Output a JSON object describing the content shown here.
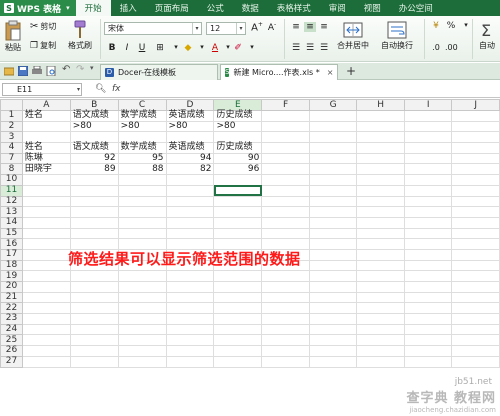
{
  "app": {
    "logo_label": "WPS 表格"
  },
  "menu": {
    "tabs": [
      {
        "label": "开始"
      },
      {
        "label": "插入"
      },
      {
        "label": "页面布局"
      },
      {
        "label": "公式"
      },
      {
        "label": "数据"
      },
      {
        "label": "表格样式"
      },
      {
        "label": "审阅"
      },
      {
        "label": "视图"
      },
      {
        "label": "办公空间"
      }
    ]
  },
  "ribbon": {
    "paste_label": "粘贴",
    "cut_label": "剪切",
    "copy_label": "复制",
    "format_painter_label": "格式刷",
    "font_name": "宋体",
    "font_size": "12",
    "merge_center_label": "合并居中",
    "wrap_text_label": "自动换行",
    "auto_label": "自动"
  },
  "doc_tabs": [
    {
      "label": "Docer-在线模板"
    },
    {
      "label": "新建 Micro....作表.xls *"
    }
  ],
  "formula_bar": {
    "name_box": "E11",
    "fx": "fx",
    "formula": ""
  },
  "sheet": {
    "columns": [
      "A",
      "B",
      "C",
      "D",
      "E",
      "F",
      "G",
      "H",
      "I",
      "J"
    ],
    "selected_column": "E",
    "selected_row": 11,
    "active_cell": "E11",
    "rows": [
      {
        "num": "1",
        "cells": [
          "姓名",
          "语文成绩",
          "数学成绩",
          "英语成绩",
          "历史成绩",
          "",
          "",
          "",
          "",
          ""
        ]
      },
      {
        "num": "2",
        "cells": [
          "",
          ">80",
          ">80",
          ">80",
          ">80",
          "",
          "",
          "",
          "",
          ""
        ]
      },
      {
        "num": "3",
        "cells": [
          "",
          "",
          "",
          "",
          "",
          "",
          "",
          "",
          "",
          ""
        ]
      },
      {
        "num": "4",
        "cells": [
          "姓名",
          "语文成绩",
          "数学成绩",
          "英语成绩",
          "历史成绩",
          "",
          "",
          "",
          "",
          ""
        ]
      },
      {
        "num": "7",
        "cells": [
          "陈琳",
          "92",
          "95",
          "94",
          "90",
          "",
          "",
          "",
          "",
          ""
        ]
      },
      {
        "num": "8",
        "cells": [
          "田晓宇",
          "89",
          "88",
          "82",
          "96",
          "",
          "",
          "",
          "",
          ""
        ]
      },
      {
        "num": "10",
        "cells": [
          "",
          "",
          "",
          "",
          "",
          "",
          "",
          "",
          "",
          ""
        ]
      },
      {
        "num": "11",
        "cells": [
          "",
          "",
          "",
          "",
          "",
          "",
          "",
          "",
          "",
          ""
        ]
      },
      {
        "num": "12",
        "cells": [
          "",
          "",
          "",
          "",
          "",
          "",
          "",
          "",
          "",
          ""
        ]
      },
      {
        "num": "13",
        "cells": [
          "",
          "",
          "",
          "",
          "",
          "",
          "",
          "",
          "",
          ""
        ]
      },
      {
        "num": "14",
        "cells": [
          "",
          "",
          "",
          "",
          "",
          "",
          "",
          "",
          "",
          ""
        ]
      },
      {
        "num": "15",
        "cells": [
          "",
          "",
          "",
          "",
          "",
          "",
          "",
          "",
          "",
          ""
        ]
      },
      {
        "num": "16",
        "cells": [
          "",
          "",
          "",
          "",
          "",
          "",
          "",
          "",
          "",
          ""
        ]
      },
      {
        "num": "17",
        "cells": [
          "",
          "",
          "",
          "",
          "",
          "",
          "",
          "",
          "",
          ""
        ]
      },
      {
        "num": "18",
        "cells": [
          "",
          "",
          "",
          "",
          "",
          "",
          "",
          "",
          "",
          ""
        ]
      },
      {
        "num": "19",
        "cells": [
          "",
          "",
          "",
          "",
          "",
          "",
          "",
          "",
          "",
          ""
        ]
      },
      {
        "num": "20",
        "cells": [
          "",
          "",
          "",
          "",
          "",
          "",
          "",
          "",
          "",
          ""
        ]
      },
      {
        "num": "21",
        "cells": [
          "",
          "",
          "",
          "",
          "",
          "",
          "",
          "",
          "",
          ""
        ]
      },
      {
        "num": "22",
        "cells": [
          "",
          "",
          "",
          "",
          "",
          "",
          "",
          "",
          "",
          ""
        ]
      },
      {
        "num": "23",
        "cells": [
          "",
          "",
          "",
          "",
          "",
          "",
          "",
          "",
          "",
          ""
        ]
      },
      {
        "num": "24",
        "cells": [
          "",
          "",
          "",
          "",
          "",
          "",
          "",
          "",
          "",
          ""
        ]
      },
      {
        "num": "25",
        "cells": [
          "",
          "",
          "",
          "",
          "",
          "",
          "",
          "",
          "",
          ""
        ]
      },
      {
        "num": "26",
        "cells": [
          "",
          "",
          "",
          "",
          "",
          "",
          "",
          "",
          "",
          ""
        ]
      },
      {
        "num": "27",
        "cells": [
          "",
          "",
          "",
          "",
          "",
          "",
          "",
          "",
          "",
          ""
        ]
      }
    ]
  },
  "annotation": {
    "text": "筛选结果可以显示筛选范围的数据"
  },
  "watermark": {
    "line1": "查字典 教程网",
    "line2": "jiaocheng.chazidian.com",
    "line3": "jb51.net"
  },
  "colors": {
    "accent": "#1d6d3b",
    "annotation": "#ff1a1a",
    "selection": "#217346"
  }
}
